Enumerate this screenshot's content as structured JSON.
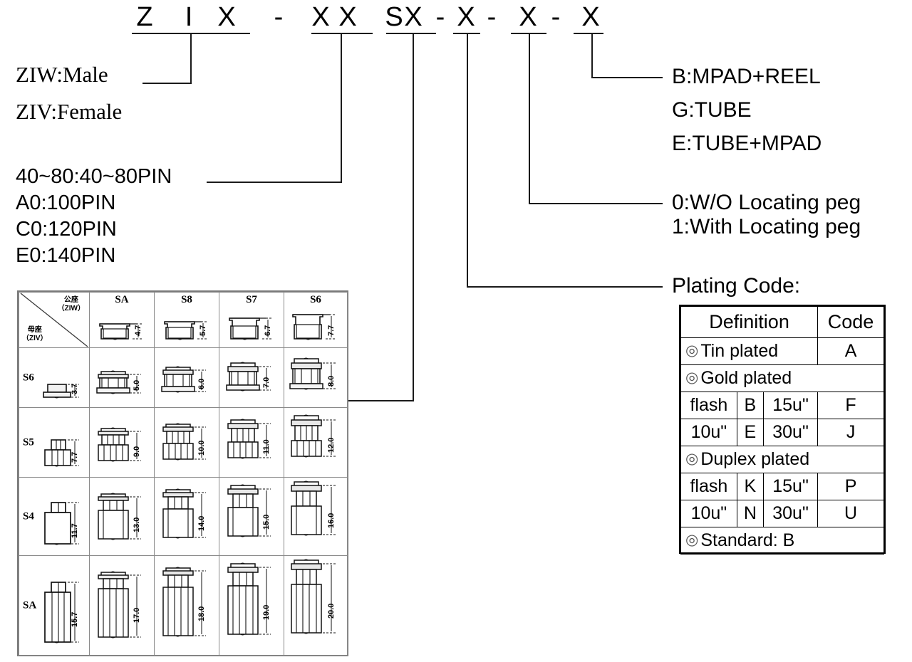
{
  "part_number": {
    "chars": [
      "Z",
      "I",
      "X",
      "-",
      "X",
      "X",
      "S",
      "X",
      "-",
      "X",
      "-",
      "X",
      "-",
      "X"
    ],
    "display": "ZIX-XXSX-X-X-X"
  },
  "left_labels": {
    "gender": [
      "ZIW:Male",
      "ZIV:Female"
    ],
    "pin_count": [
      "40~80:40~80PIN",
      "A0:100PIN",
      "C0:120PIN",
      "E0:140PIN"
    ]
  },
  "right_labels": {
    "packaging": [
      "B:MPAD+REEL",
      "G:TUBE",
      "E:TUBE+MPAD"
    ],
    "locating_peg": [
      "0:W/O Locating peg",
      "1:With Locating peg"
    ],
    "plating_title": "Plating Code:"
  },
  "plating_table": {
    "header": [
      "Definition",
      "Code"
    ],
    "rows": [
      {
        "type": "simple",
        "bullet": "◎",
        "definition": "Tin plated",
        "code": "A"
      },
      {
        "type": "group",
        "bullet": "◎",
        "definition": "Gold plated"
      },
      {
        "type": "quad",
        "cells": [
          "flash",
          "B",
          "15u\"",
          "F"
        ]
      },
      {
        "type": "quad",
        "cells": [
          "10u\"",
          "E",
          "30u\"",
          "J"
        ]
      },
      {
        "type": "group",
        "bullet": "◎",
        "definition": "Duplex plated"
      },
      {
        "type": "quad",
        "cells": [
          "flash",
          "K",
          "15u\"",
          "P"
        ]
      },
      {
        "type": "quad",
        "cells": [
          "10u\"",
          "N",
          "30u\"",
          "U"
        ]
      },
      {
        "type": "group",
        "bullet": "◎",
        "definition": "Standard: B"
      }
    ]
  },
  "matrix": {
    "corner": {
      "col_label": "公座",
      "col_sub": "（ZIW）",
      "row_label": "母座",
      "row_sub": "（ZIV）"
    },
    "col_headers": [
      "SA",
      "S8",
      "S7",
      "S6"
    ],
    "col_header_dims": [
      "4.7",
      "5.7",
      "6.7",
      "7.7"
    ],
    "row_headers": [
      "S6",
      "S5",
      "S4",
      "SA"
    ],
    "row_header_dims": [
      "3.7",
      "7.7",
      "11.7",
      "15.7"
    ],
    "stack_heights": [
      [
        "5.0",
        "6.0",
        "7.0",
        "8.0"
      ],
      [
        "9.0",
        "10.0",
        "11.0",
        "12.0"
      ],
      [
        "13.0",
        "14.0",
        "15.0",
        "16.0"
      ],
      [
        "17.0",
        "18.0",
        "19.0",
        "20.0"
      ]
    ]
  },
  "chart_data": {
    "type": "table",
    "title": "ZIX mated stack height matrix (mm)",
    "xlabel": "公座 ZIW (plug)",
    "ylabel": "母座 ZIV (receptacle)",
    "categories": [
      "SA",
      "S8",
      "S7",
      "S6"
    ],
    "row_categories": [
      "S6",
      "S5",
      "S4",
      "SA"
    ],
    "plug_standalone_heights": [
      4.7,
      5.7,
      6.7,
      7.7
    ],
    "receptacle_standalone_heights": [
      3.7,
      7.7,
      11.7,
      15.7
    ],
    "series": [
      {
        "name": "S6",
        "values": [
          5.0,
          6.0,
          7.0,
          8.0
        ]
      },
      {
        "name": "S5",
        "values": [
          9.0,
          10.0,
          11.0,
          12.0
        ]
      },
      {
        "name": "S4",
        "values": [
          13.0,
          14.0,
          15.0,
          16.0
        ]
      },
      {
        "name": "SA",
        "values": [
          17.0,
          18.0,
          19.0,
          20.0
        ]
      }
    ],
    "grid": true,
    "legend": "none"
  }
}
